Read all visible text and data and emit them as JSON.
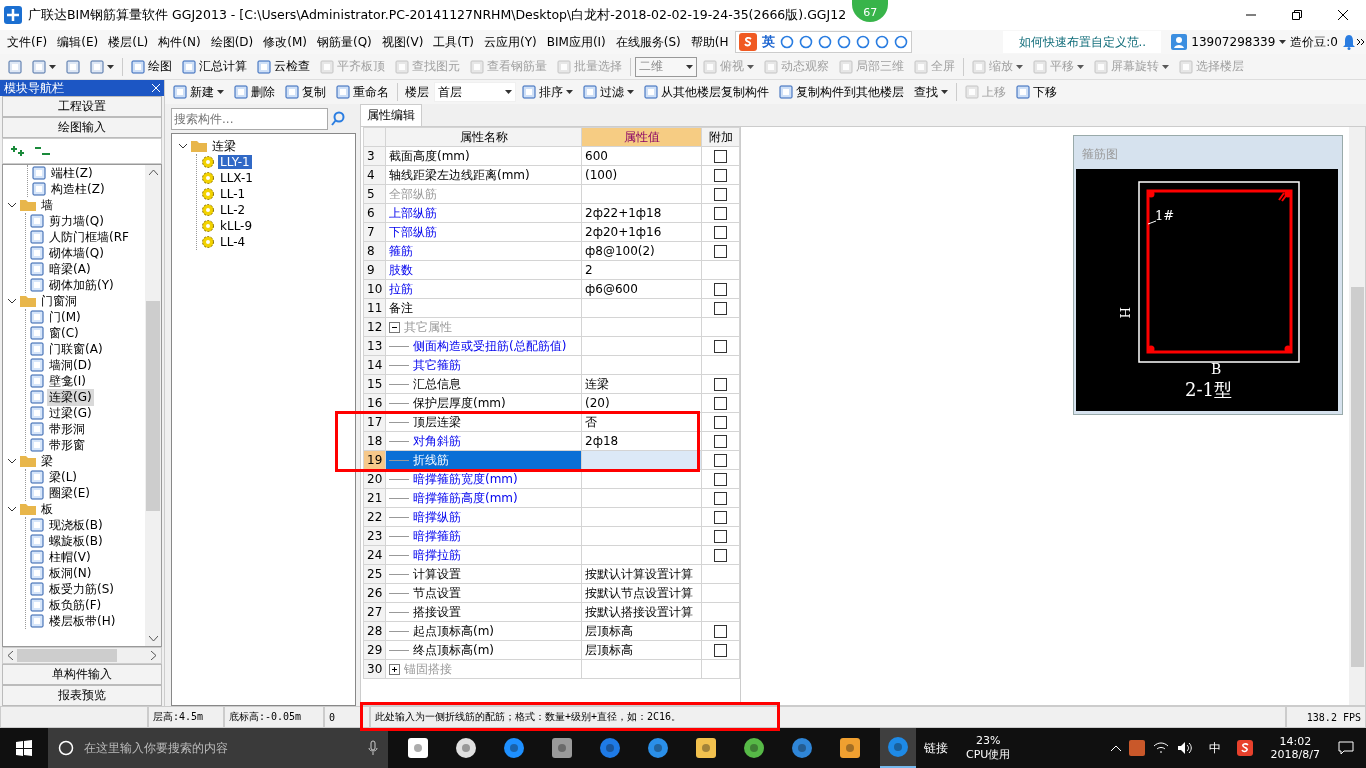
{
  "window": {
    "title": "广联达BIM钢筋算量软件 GGJ2013 - [C:\\Users\\Administrator.PC-20141127NRHM\\Desktop\\白龙村-2018-02-02-19-24-35(2666版).GGJ12"
  },
  "notification_badge": "67",
  "menu": [
    "文件(F)",
    "编辑(E)",
    "楼层(L)",
    "构件(N)",
    "绘图(D)",
    "修改(M)",
    "钢筋量(Q)",
    "视图(V)",
    "工具(T)",
    "云应用(Y)",
    "BIM应用(I)",
    "在线服务(S)",
    "帮助(H"
  ],
  "ime_toolbar": {
    "mode": "英"
  },
  "news_link": "如何快速布置自定义范..",
  "account": {
    "phone": "13907298339",
    "beans": "造价豆:0"
  },
  "toolbar": [
    {
      "kind": "icon",
      "disabled": false,
      "dropdown": false
    },
    {
      "kind": "icon",
      "disabled": false,
      "dropdown": true
    },
    {
      "kind": "icon",
      "disabled": false,
      "dropdown": false
    },
    {
      "kind": "icon",
      "disabled": false,
      "dropdown": true
    },
    {
      "kind": "button",
      "label": "绘图",
      "disabled": false,
      "dropdown": false
    },
    {
      "kind": "button",
      "label": "汇总计算",
      "disabled": false,
      "dropdown": false
    },
    {
      "kind": "button",
      "label": "云检查",
      "disabled": false,
      "dropdown": false
    },
    {
      "kind": "button",
      "label": "平齐板顶",
      "disabled": true,
      "dropdown": false
    },
    {
      "kind": "button",
      "label": "查找图元",
      "disabled": true,
      "dropdown": false
    },
    {
      "kind": "button",
      "label": "查看钢筋量",
      "disabled": true,
      "dropdown": false
    },
    {
      "kind": "button",
      "label": "批量选择",
      "disabled": true,
      "dropdown": false
    },
    {
      "kind": "combo",
      "label": "二维",
      "disabled": true,
      "dropdown": true
    },
    {
      "kind": "button",
      "label": "俯视",
      "disabled": true,
      "dropdown": true
    },
    {
      "kind": "button",
      "label": "动态观察",
      "disabled": true,
      "dropdown": false
    },
    {
      "kind": "button",
      "label": "局部三维",
      "disabled": true,
      "dropdown": false
    },
    {
      "kind": "button",
      "label": "全屏",
      "disabled": true,
      "dropdown": false
    },
    {
      "kind": "button",
      "label": "缩放",
      "disabled": true,
      "dropdown": true
    },
    {
      "kind": "button",
      "label": "平移",
      "disabled": true,
      "dropdown": true
    },
    {
      "kind": "button",
      "label": "屏幕旋转",
      "disabled": true,
      "dropdown": true
    },
    {
      "kind": "button",
      "label": "选择楼层",
      "disabled": true,
      "dropdown": false
    }
  ],
  "nav": {
    "title": "模块导航栏",
    "sections": [
      "工程设置",
      "绘图输入"
    ],
    "tree": [
      {
        "label": "端柱(Z)",
        "selected": false
      },
      {
        "label": "构造柱(Z)",
        "selected": false
      },
      {
        "label": "墙",
        "expanded": true,
        "selected": false,
        "children": [
          {
            "label": "剪力墙(Q)",
            "selected": false
          },
          {
            "label": "人防门框墙(RF",
            "selected": false
          },
          {
            "label": "砌体墙(Q)",
            "selected": false
          },
          {
            "label": "暗梁(A)",
            "selected": false
          },
          {
            "label": "砌体加筋(Y)",
            "selected": false
          }
        ]
      },
      {
        "label": "门窗洞",
        "expanded": true,
        "selected": false,
        "children": [
          {
            "label": "门(M)",
            "selected": false
          },
          {
            "label": "窗(C)",
            "selected": false
          },
          {
            "label": "门联窗(A)",
            "selected": false
          },
          {
            "label": "墙洞(D)",
            "selected": false
          },
          {
            "label": "壁龛(I)",
            "selected": false
          },
          {
            "label": "连梁(G)",
            "selected": true
          },
          {
            "label": "过梁(G)",
            "selected": false
          },
          {
            "label": "带形洞",
            "selected": false
          },
          {
            "label": "带形窗",
            "selected": false
          }
        ]
      },
      {
        "label": "梁",
        "expanded": true,
        "selected": false,
        "children": [
          {
            "label": "梁(L)",
            "selected": false
          },
          {
            "label": "圈梁(E)",
            "selected": false
          }
        ]
      },
      {
        "label": "板",
        "expanded": true,
        "selected": false,
        "children": [
          {
            "label": "现浇板(B)",
            "selected": false
          },
          {
            "label": "螺旋板(B)",
            "selected": false
          },
          {
            "label": "柱帽(V)",
            "selected": false
          },
          {
            "label": "板洞(N)",
            "selected": false
          },
          {
            "label": "板受力筋(S)",
            "selected": false
          },
          {
            "label": "板负筋(F)",
            "selected": false
          },
          {
            "label": "楼层板带(H)",
            "selected": false
          }
        ]
      }
    ],
    "bottom_sections": [
      "单构件输入",
      "报表预览"
    ]
  },
  "component_toolbar": [
    {
      "kind": "button",
      "label": "新建",
      "disabled": false,
      "dropdown": true
    },
    {
      "kind": "button",
      "label": "删除",
      "disabled": false,
      "dropdown": false
    },
    {
      "kind": "button",
      "label": "复制",
      "disabled": false,
      "dropdown": false
    },
    {
      "kind": "button",
      "label": "重命名",
      "disabled": false,
      "dropdown": false
    },
    {
      "kind": "label",
      "label": "楼层"
    },
    {
      "kind": "combo",
      "label": "首层",
      "disabled": false,
      "dropdown": true
    },
    {
      "kind": "button",
      "label": "排序",
      "disabled": false,
      "dropdown": true
    },
    {
      "kind": "button",
      "label": "过滤",
      "disabled": false,
      "dropdown": true
    },
    {
      "kind": "button",
      "label": "从其他楼层复制构件",
      "disabled": false,
      "dropdown": false
    },
    {
      "kind": "button",
      "label": "复制构件到其他楼层",
      "disabled": false,
      "dropdown": false
    },
    {
      "kind": "text",
      "label": "查找",
      "disabled": false,
      "dropdown": true
    },
    {
      "kind": "button",
      "label": "上移",
      "disabled": true,
      "dropdown": false
    },
    {
      "kind": "button",
      "label": "下移",
      "disabled": false,
      "dropdown": false
    }
  ],
  "component_search": {
    "placeholder": "搜索构件..."
  },
  "components": [
    {
      "label": "连梁",
      "expanded": true,
      "selected": false,
      "children": [
        {
          "label": "LLY-1",
          "selected": true
        },
        {
          "label": "LLX-1",
          "selected": false
        },
        {
          "label": "LL-1",
          "selected": false
        },
        {
          "label": "LL-2",
          "selected": false
        },
        {
          "label": "kLL-9",
          "selected": false
        },
        {
          "label": "LL-4",
          "selected": false
        }
      ]
    }
  ],
  "tabs": [
    {
      "label": "属性编辑",
      "selected": true
    }
  ],
  "properties": {
    "columns": [
      "属性名称",
      "属性值",
      "附加"
    ],
    "rows": [
      {
        "num": "3",
        "name": "截面高度(mm)",
        "value": "600",
        "kind": "normal",
        "checked": false,
        "selected": false
      },
      {
        "num": "4",
        "name": "轴线距梁左边线距离(mm)",
        "value": "(100)",
        "kind": "normal",
        "checked": false,
        "selected": false
      },
      {
        "num": "5",
        "name": "全部纵筋",
        "kind": "grey",
        "checked": false,
        "selected": false
      },
      {
        "num": "6",
        "name": "上部纵筋",
        "value": "2ф22+1ф18",
        "kind": "link",
        "checked": false,
        "selected": false
      },
      {
        "num": "7",
        "name": "下部纵筋",
        "value": "2ф20+1ф16",
        "kind": "link",
        "checked": false,
        "selected": false
      },
      {
        "num": "8",
        "name": "箍筋",
        "value": "ф8@100(2)",
        "kind": "link",
        "checked": false,
        "selected": false
      },
      {
        "num": "9",
        "name": "肢数",
        "value": "2",
        "kind": "link",
        "selected": false
      },
      {
        "num": "10",
        "name": "拉筋",
        "value": "ф6@600",
        "kind": "link",
        "checked": false,
        "selected": false
      },
      {
        "num": "11",
        "name": "备注",
        "kind": "normal",
        "checked": false,
        "selected": false
      },
      {
        "num": "12",
        "name": "其它属性",
        "kind": "grey",
        "expanded": true,
        "selected": false,
        "children": [
          {
            "num": "13",
            "name": "侧面构造或受扭筋(总配筋值)",
            "kind": "link",
            "checked": false,
            "selected": false
          },
          {
            "num": "14",
            "name": "其它箍筋",
            "kind": "link",
            "selected": false
          },
          {
            "num": "15",
            "name": "汇总信息",
            "value": "连梁",
            "kind": "normal",
            "checked": false,
            "selected": false
          },
          {
            "num": "16",
            "name": "保护层厚度(mm)",
            "value": "(20)",
            "kind": "normal",
            "checked": false,
            "selected": false
          },
          {
            "num": "17",
            "name": "顶层连梁",
            "value": "否",
            "kind": "normal",
            "checked": false,
            "selected": false,
            "annotated": true
          },
          {
            "num": "18",
            "name": "对角斜筋",
            "value": "2ф18",
            "kind": "link",
            "checked": false,
            "selected": false,
            "annotated": true
          },
          {
            "num": "19",
            "name": "折线筋",
            "kind": "link",
            "checked": false,
            "selected": true,
            "annotated": true
          },
          {
            "num": "20",
            "name": "暗撑箍筋宽度(mm)",
            "kind": "link",
            "checked": false,
            "selected": false
          },
          {
            "num": "21",
            "name": "暗撑箍筋高度(mm)",
            "kind": "link",
            "checked": false,
            "selected": false
          },
          {
            "num": "22",
            "name": "暗撑纵筋",
            "kind": "link",
            "checked": false,
            "selected": false
          },
          {
            "num": "23",
            "name": "暗撑箍筋",
            "kind": "link",
            "checked": false,
            "selected": false
          },
          {
            "num": "24",
            "name": "暗撑拉筋",
            "kind": "link",
            "checked": false,
            "selected": false
          },
          {
            "num": "25",
            "name": "计算设置",
            "value": "按默认计算设置计算",
            "kind": "normal",
            "selected": false
          },
          {
            "num": "26",
            "name": "节点设置",
            "value": "按默认节点设置计算",
            "kind": "normal",
            "selected": false
          },
          {
            "num": "27",
            "name": "搭接设置",
            "value": "按默认搭接设置计算",
            "kind": "normal",
            "selected": false
          },
          {
            "num": "28",
            "name": "起点顶标高(m)",
            "value": "层顶标高",
            "kind": "normal",
            "checked": false,
            "selected": false
          },
          {
            "num": "29",
            "name": "终点顶标高(m)",
            "value": "层顶标高",
            "kind": "normal",
            "checked": false,
            "selected": false
          }
        ]
      },
      {
        "num": "30",
        "name": "锚固搭接",
        "kind": "grey",
        "expanded": false,
        "selected": false
      }
    ]
  },
  "stirrup_diagram": {
    "title": "箍筋图",
    "bar_label": "1#",
    "height_label": "H",
    "width_label": "B",
    "type_label": "2-1型"
  },
  "status_bar": {
    "floor_height": "层高:4.5m",
    "base_elevation": "底标高:-0.05m",
    "cell_3": "0",
    "message": "此处输入为一侧折线筋的配筋；格式：数量+级别+直径，如：2C16。",
    "message_annotated": true,
    "fps": "138.2 FPS"
  },
  "taskbar": {
    "search_placeholder": "在这里输入你要搜索的内容",
    "links": "链接",
    "cpu_value": "23%",
    "cpu_label": "CPU使用",
    "input_language": "中",
    "time": "14:02",
    "date": "2018/8/7"
  }
}
